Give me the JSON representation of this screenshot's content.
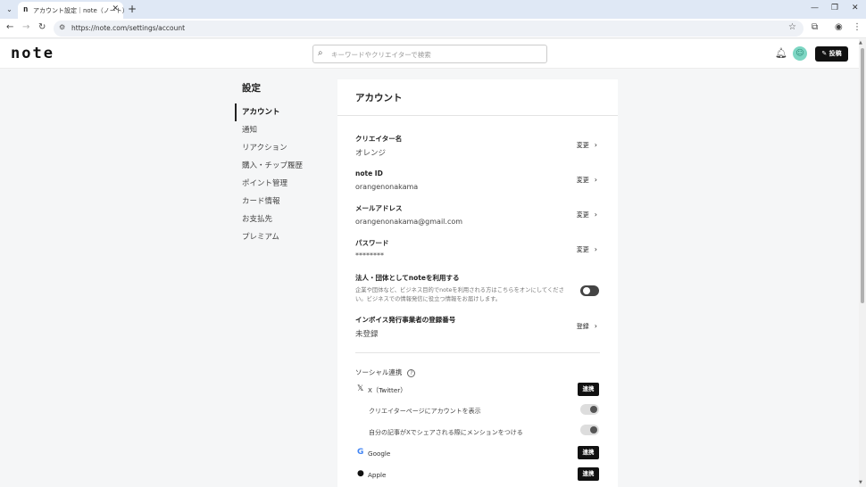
{
  "browser": {
    "tab_title": "アカウント設定｜note（ノート）",
    "favicon": "n",
    "tab_close": "✕",
    "new_tab": "+",
    "url": "https://note.com/settings/account"
  },
  "header": {
    "logo": "note",
    "search_placeholder": "キーワードやクリエイターで検索",
    "post_button": "投稿"
  },
  "sidebar": {
    "title": "設定",
    "items": [
      {
        "label": "アカウント"
      },
      {
        "label": "通知"
      },
      {
        "label": "リアクション"
      },
      {
        "label": "購入・チップ履歴"
      },
      {
        "label": "ポイント管理"
      },
      {
        "label": "カード情報"
      },
      {
        "label": "お支払先"
      },
      {
        "label": "プレミアム"
      }
    ]
  },
  "account": {
    "title": "アカウント",
    "creator_name": {
      "label": "クリエイター名",
      "value": "オレンジ",
      "action": "変更"
    },
    "note_id": {
      "label": "note ID",
      "value": "orangenonakama",
      "action": "変更"
    },
    "email": {
      "label": "メールアドレス",
      "value": "orangenonakama@gmail.com",
      "action": "変更"
    },
    "password": {
      "label": "パスワード",
      "value": "********",
      "action": "変更"
    },
    "corporate": {
      "label": "法人・団体としてnoteを利用する",
      "description": "企業や団体など、ビジネス目的でnoteを利用される方はこちらをオンにしてください。ビジネスでの情報発信に役立つ情報をお届けします。",
      "enabled": true
    },
    "invoice": {
      "label": "インボイス発行事業者の登録番号",
      "value": "未登録",
      "action": "登録"
    }
  },
  "social": {
    "heading": "ソーシャル連携",
    "twitter": {
      "name": "X（Twitter）",
      "button": "連携"
    },
    "twitter_options": [
      {
        "label": "クリエイターページにアカウントを表示",
        "enabled": false
      },
      {
        "label": "自分の記事がXでシェアされる際にメンションをつける",
        "enabled": false
      }
    ],
    "google": {
      "name": "Google",
      "button": "連携"
    },
    "apple": {
      "name": "Apple",
      "button": "連携"
    }
  }
}
